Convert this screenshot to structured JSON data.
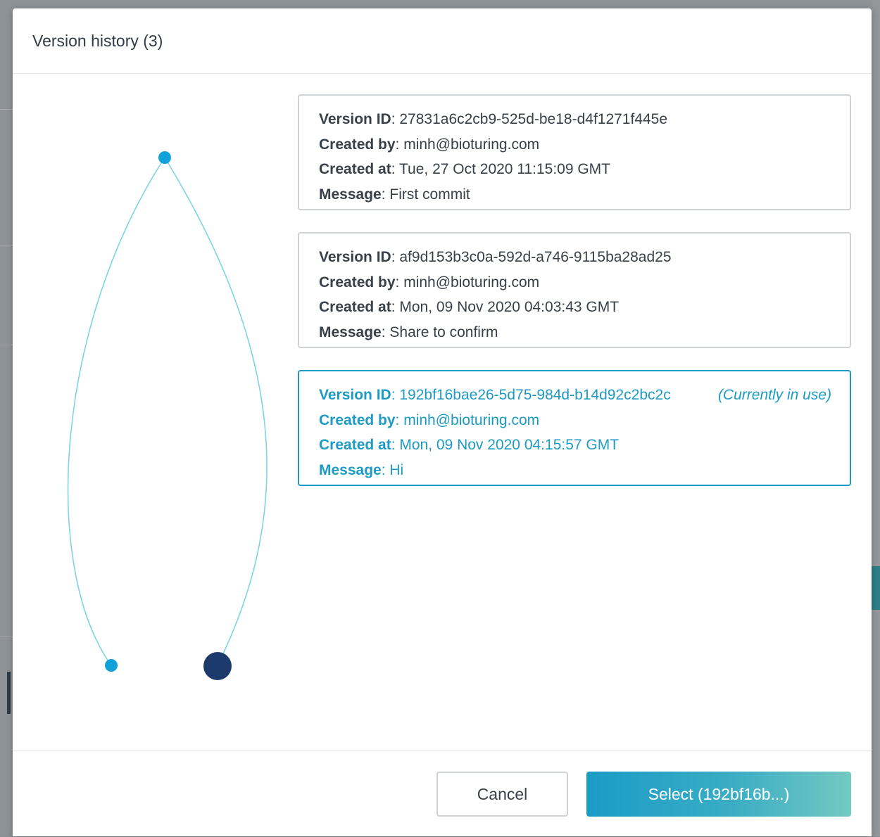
{
  "modal": {
    "title": "Version history (3)"
  },
  "graph": {
    "edge_color": "#7fd3e6",
    "node_color": "#12a1d8",
    "current_node_color": "#1c3a6b"
  },
  "versions": [
    {
      "id_label": "Version ID",
      "id": "27831a6c2cb9-525d-be18-d4f1271f445e",
      "created_by_label": "Created by",
      "created_by": "minh@bioturing.com",
      "created_at_label": "Created at",
      "created_at": "Tue, 27 Oct 2020 11:15:09 GMT",
      "message_label": "Message",
      "message": "First commit"
    },
    {
      "id_label": "Version ID",
      "id": "af9d153b3c0a-592d-a746-9115ba28ad25",
      "created_by_label": "Created by",
      "created_by": "minh@bioturing.com",
      "created_at_label": "Created at",
      "created_at": "Mon, 09 Nov 2020 04:03:43 GMT",
      "message_label": "Message",
      "message": "Share to confirm"
    },
    {
      "id_label": "Version ID",
      "id": "192bf16bae26-5d75-984d-b14d92c2bc2c",
      "in_use": "(Currently in use)",
      "created_by_label": "Created by",
      "created_by": "minh@bioturing.com",
      "created_at_label": "Created at",
      "created_at": "Mon, 09 Nov 2020 04:15:57 GMT",
      "message_label": "Message",
      "message": "Hi"
    }
  ],
  "footer": {
    "cancel_label": "Cancel",
    "select_label": "Select (192bf16b...)"
  }
}
